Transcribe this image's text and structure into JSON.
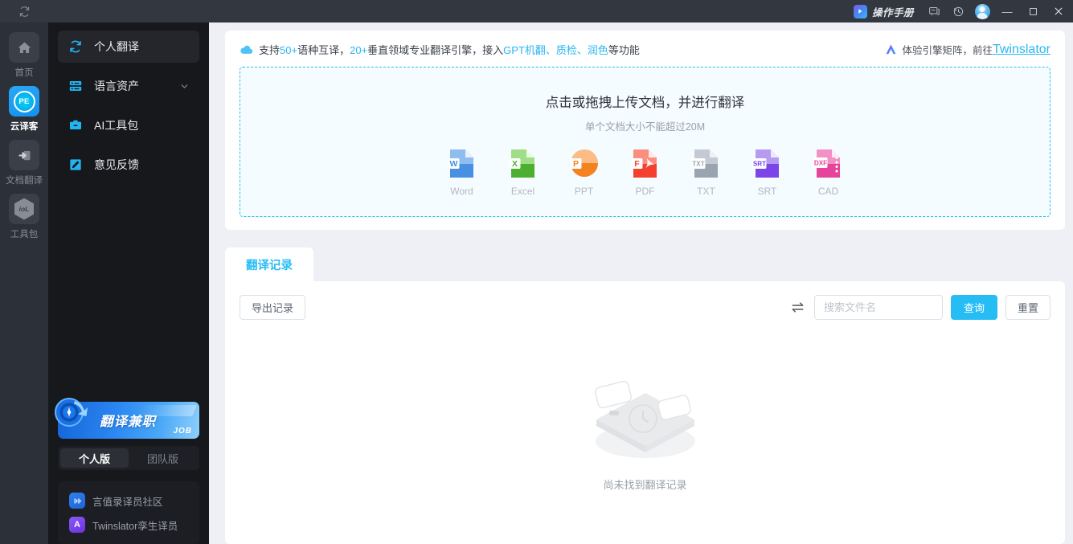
{
  "titlebar": {
    "sync_icon": "sync-icon",
    "manual_label": "操作手册",
    "manual_icon": "manual-play-icon",
    "feedback_icon": "chat-icon",
    "history_icon": "history-icon",
    "avatar_icon": "user-avatar",
    "minimize_label": "—",
    "maximize_label": "▢",
    "close_label": "✕"
  },
  "rail": {
    "items": [
      {
        "label": "首页",
        "icon": "home-icon",
        "active": false
      },
      {
        "label": "云译客",
        "icon": "pe-logo-icon",
        "active": true
      },
      {
        "label": "文档翻译",
        "icon": "document-translate-icon",
        "active": false
      },
      {
        "label": "工具包",
        "icon": "iol-toolkit-icon",
        "active": false
      }
    ]
  },
  "sidebar": {
    "items": [
      {
        "label": "个人翻译",
        "icon": "refresh-circle-icon",
        "active": true,
        "chevron": false
      },
      {
        "label": "语言资产",
        "icon": "server-stack-icon",
        "active": false,
        "chevron": true
      },
      {
        "label": "AI工具包",
        "icon": "toolbox-icon",
        "active": false,
        "chevron": false
      },
      {
        "label": "意见反馈",
        "icon": "feedback-edit-icon",
        "active": false,
        "chevron": false
      }
    ],
    "promo": {
      "title": "翻译兼职",
      "badge": "JOB",
      "icon": "translator-job-badge-icon"
    },
    "version_switch": {
      "options": [
        {
          "label": "个人版",
          "active": true
        },
        {
          "label": "团队版",
          "active": false
        }
      ]
    },
    "community": {
      "items": [
        {
          "label": "言值录译员社区",
          "icon": "yanzhilu-icon",
          "color": "#2f7ff0"
        },
        {
          "label": "Twinslator孪生译员",
          "icon": "twinslator-icon",
          "color": "#8a5bf5"
        }
      ]
    }
  },
  "banner": {
    "cloud_icon": "cloud-icon",
    "segments": [
      {
        "text": "支持",
        "highlight": false
      },
      {
        "text": "50+",
        "highlight": true
      },
      {
        "text": "语种互译，",
        "highlight": false
      },
      {
        "text": "20+",
        "highlight": true
      },
      {
        "text": "垂直领域专业翻译引擎，接入",
        "highlight": false
      },
      {
        "text": "GPT机翻、质检、润色",
        "highlight": true
      },
      {
        "text": "等功能",
        "highlight": false
      }
    ],
    "right_icon": "twinslator-a-icon",
    "right_text": "体验引擎矩阵，前往",
    "right_link": "Twinslator"
  },
  "dropzone": {
    "title": "点击或拖拽上传文档，并进行翻译",
    "subtitle": "单个文档大小不能超过20M",
    "types": [
      {
        "label": "Word",
        "tag": "W",
        "color": "#4a90e2",
        "light": "#8fbdf0",
        "icon": "word-file-icon"
      },
      {
        "label": "Excel",
        "tag": "X",
        "color": "#4caf2f",
        "light": "#9fdd86",
        "icon": "excel-file-icon"
      },
      {
        "label": "PPT",
        "tag": "P",
        "color": "#f58220",
        "light": "#fbbc85",
        "icon": "ppt-file-icon"
      },
      {
        "label": "PDF",
        "tag": "F",
        "color": "#f4402f",
        "light": "#fa8e80",
        "icon": "pdf-file-icon"
      },
      {
        "label": "TXT",
        "tag": "TXT",
        "color": "#9aa3b0",
        "light": "#c4cad3",
        "icon": "txt-file-icon"
      },
      {
        "label": "SRT",
        "tag": "SRT",
        "color": "#7b45e8",
        "light": "#b79bf3",
        "icon": "srt-file-icon"
      },
      {
        "label": "CAD",
        "tag": "DXF",
        "color": "#e5449a",
        "light": "#f292c4",
        "icon": "cad-file-icon"
      }
    ]
  },
  "records": {
    "tab_label": "翻译记录",
    "export_label": "导出记录",
    "swap_icon": "swap-arrows-icon",
    "search_placeholder": "搜索文件名",
    "search_value": "",
    "query_label": "查询",
    "reset_label": "重置",
    "empty_text": "尚未找到翻译记录",
    "empty_illustration": "empty-box-illustration"
  },
  "colors": {
    "accent": "#26bdf5",
    "titlebar_bg": "#33373f",
    "rail_bg": "#2c3038",
    "sidebar_bg": "#16181c",
    "main_bg": "#eef0f5"
  }
}
